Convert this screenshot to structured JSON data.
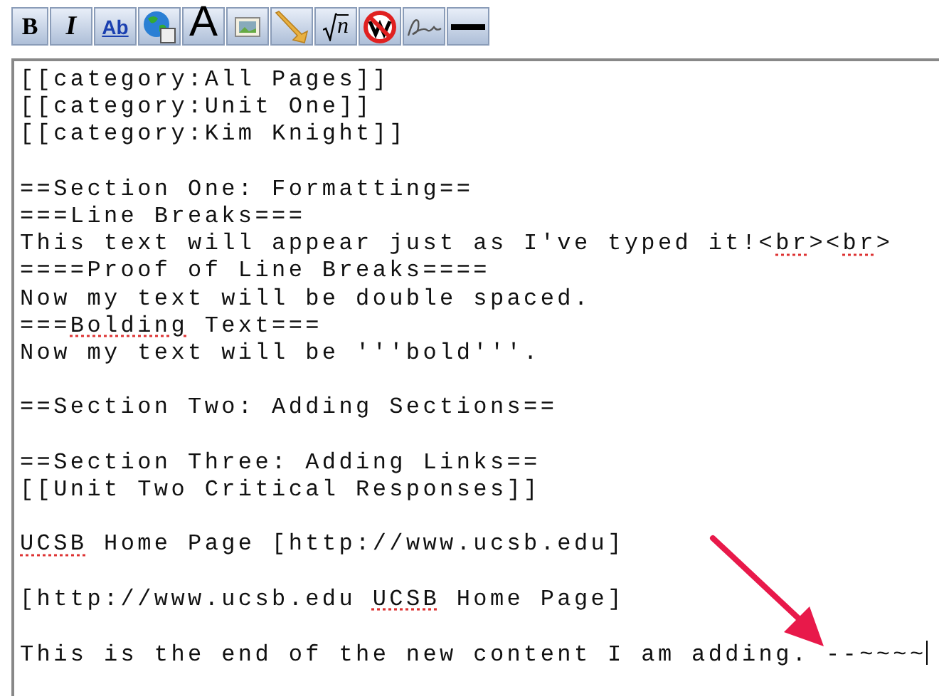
{
  "toolbar": [
    {
      "kind": "bold",
      "label": "B"
    },
    {
      "kind": "italic",
      "label": "I"
    },
    {
      "kind": "link",
      "label": "Ab"
    },
    {
      "kind": "globe"
    },
    {
      "kind": "headline",
      "label": "A"
    },
    {
      "kind": "image"
    },
    {
      "kind": "media"
    },
    {
      "kind": "math",
      "label": "n"
    },
    {
      "kind": "nowiki"
    },
    {
      "kind": "signature"
    },
    {
      "kind": "rule"
    }
  ],
  "editor": {
    "cursor_at_end": true,
    "blocks": [
      [
        [
          {
            "text": "[[category:All Pages]]"
          }
        ],
        [
          {
            "text": "[[category:Unit One]]"
          }
        ],
        [
          {
            "text": "[[category:Kim Knight]]"
          }
        ]
      ],
      [
        [
          {
            "text": "==Section One: Formatting=="
          }
        ],
        [
          {
            "text": "===Line Breaks==="
          }
        ],
        [
          {
            "text": "This text will appear just as I've typed it!<"
          },
          {
            "text": "br",
            "misspelled": true
          },
          {
            "text": "><"
          },
          {
            "text": "br",
            "misspelled": true
          },
          {
            "text": ">"
          }
        ],
        [
          {
            "text": "====Proof of Line Breaks===="
          }
        ],
        [
          {
            "text": "Now my text will be double spaced."
          }
        ],
        [
          {
            "text": "==="
          },
          {
            "text": "Bolding",
            "misspelled": true
          },
          {
            "text": " Text==="
          }
        ],
        [
          {
            "text": "Now my text will be '''bold'''."
          }
        ]
      ],
      [
        [
          {
            "text": "==Section Two: Adding Sections=="
          }
        ]
      ],
      [
        [
          {
            "text": "==Section Three: Adding Links=="
          }
        ],
        [
          {
            "text": "[[Unit Two Critical Responses]]"
          }
        ]
      ],
      [
        [
          {
            "text": "UCSB",
            "misspelled": true
          },
          {
            "text": " Home Page [http://www.ucsb.edu]"
          }
        ]
      ],
      [
        [
          {
            "text": "[http://www.ucsb.edu "
          },
          {
            "text": "UCSB",
            "misspelled": true
          },
          {
            "text": " Home Page]"
          }
        ]
      ],
      [
        [
          {
            "text": "This is the end of the new content I am adding. --~~~~"
          }
        ]
      ]
    ]
  }
}
